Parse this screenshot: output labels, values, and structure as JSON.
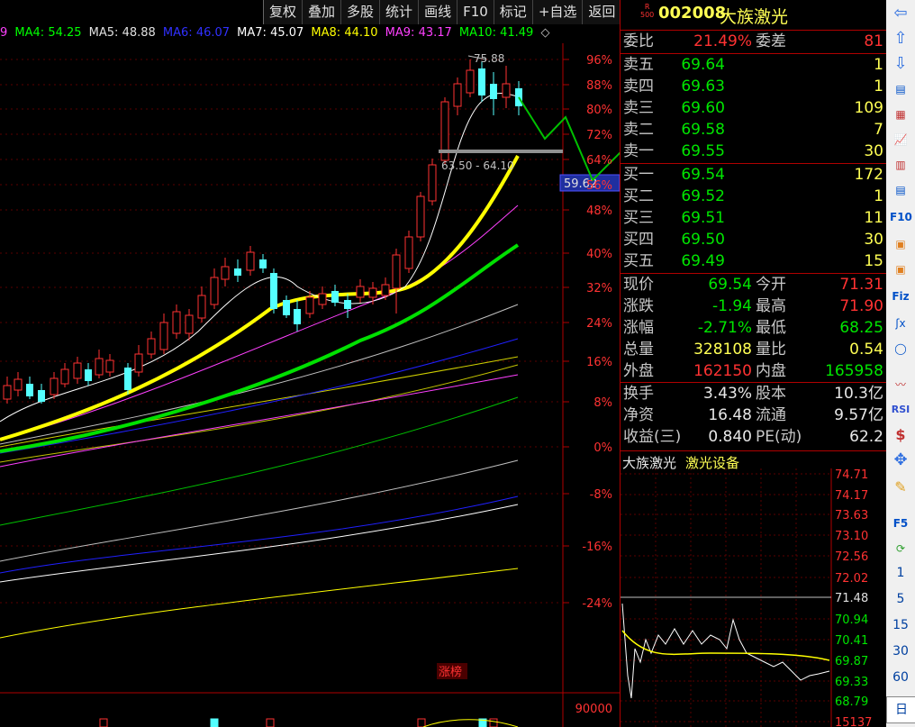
{
  "toolbar": {
    "items": [
      "复权",
      "叠加",
      "多股",
      "统计",
      "画线",
      "F10",
      "标记",
      "+自选",
      "返回"
    ]
  },
  "ma_legend": [
    {
      "label": "9",
      "color": "#ff40ff"
    },
    {
      "label": "MA4: 54.25",
      "color": "#00ff00"
    },
    {
      "label": "MA5: 48.88",
      "color": "#e0e0e0"
    },
    {
      "label": "MA6: 46.07",
      "color": "#2020ff"
    },
    {
      "label": "MA7: 45.07",
      "color": "#ffffff"
    },
    {
      "label": "MA8: 44.10",
      "color": "#ffff00"
    },
    {
      "label": "MA9: 43.17",
      "color": "#ff40ff"
    },
    {
      "label": "MA10: 41.49",
      "color": "#00ff00"
    }
  ],
  "chart": {
    "high_label": "75.88",
    "range_label": "63.50 - 64.10",
    "current_price_tag": "59.62",
    "event_label": "涨榜",
    "volume_axis_label": "90000",
    "pct_axis": [
      "96%",
      "88%",
      "80%",
      "72%",
      "64%",
      "56%",
      "48%",
      "40%",
      "32%",
      "24%",
      "16%",
      "8%",
      "0%",
      "-8%",
      "-16%",
      "-24%"
    ]
  },
  "quote": {
    "code_badge": "R\n500",
    "code": "002008",
    "name": "大族激光",
    "weibi": {
      "label": "委比",
      "value": "21.49%",
      "label2": "委差",
      "value2": "81"
    },
    "sells": [
      {
        "label": "卖五",
        "price": "69.64",
        "vol": "1"
      },
      {
        "label": "卖四",
        "price": "69.63",
        "vol": "1"
      },
      {
        "label": "卖三",
        "price": "69.60",
        "vol": "109"
      },
      {
        "label": "卖二",
        "price": "69.58",
        "vol": "7"
      },
      {
        "label": "卖一",
        "price": "69.55",
        "vol": "30"
      }
    ],
    "buys": [
      {
        "label": "买一",
        "price": "69.54",
        "vol": "172"
      },
      {
        "label": "买二",
        "price": "69.52",
        "vol": "1"
      },
      {
        "label": "买三",
        "price": "69.51",
        "vol": "11"
      },
      {
        "label": "买四",
        "price": "69.50",
        "vol": "30"
      },
      {
        "label": "买五",
        "price": "69.49",
        "vol": "15"
      }
    ],
    "stats1": [
      {
        "l": "现价",
        "v": "69.54",
        "vc": "green",
        "l2": "今开",
        "v2": "71.31",
        "v2c": "red"
      },
      {
        "l": "涨跌",
        "v": "-1.94",
        "vc": "green",
        "l2": "最高",
        "v2": "71.90",
        "v2c": "red"
      },
      {
        "l": "涨幅",
        "v": "-2.71%",
        "vc": "green",
        "l2": "最低",
        "v2": "68.25",
        "v2c": "green"
      },
      {
        "l": "总量",
        "v": "328108",
        "vc": "yellow",
        "l2": "量比",
        "v2": "0.54",
        "v2c": "yellow"
      },
      {
        "l": "外盘",
        "v": "162150",
        "vc": "red",
        "l2": "内盘",
        "v2": "165958",
        "v2c": "green"
      }
    ],
    "stats2": [
      {
        "l": "换手",
        "v": "3.43%",
        "vc": "white",
        "l2": "股本",
        "v2": "10.3亿",
        "v2c": "white"
      },
      {
        "l": "净资",
        "v": "16.48",
        "vc": "white",
        "l2": "流通",
        "v2": "9.57亿",
        "v2c": "white"
      },
      {
        "l": "收益(三)",
        "v": "0.840",
        "vc": "white",
        "l2": "PE(动)",
        "v2": "62.2",
        "v2c": "white"
      }
    ],
    "intraday": {
      "name": "大族激光",
      "industry": "激光设备",
      "axis": [
        "74.71",
        "74.17",
        "73.63",
        "73.10",
        "72.56",
        "72.02",
        "71.48",
        "70.94",
        "70.41",
        "69.87",
        "69.33",
        "68.79",
        "15137"
      ]
    }
  },
  "sidebar": {
    "text_items": [
      "1",
      "5",
      "15",
      "30",
      "60",
      "日"
    ]
  }
}
